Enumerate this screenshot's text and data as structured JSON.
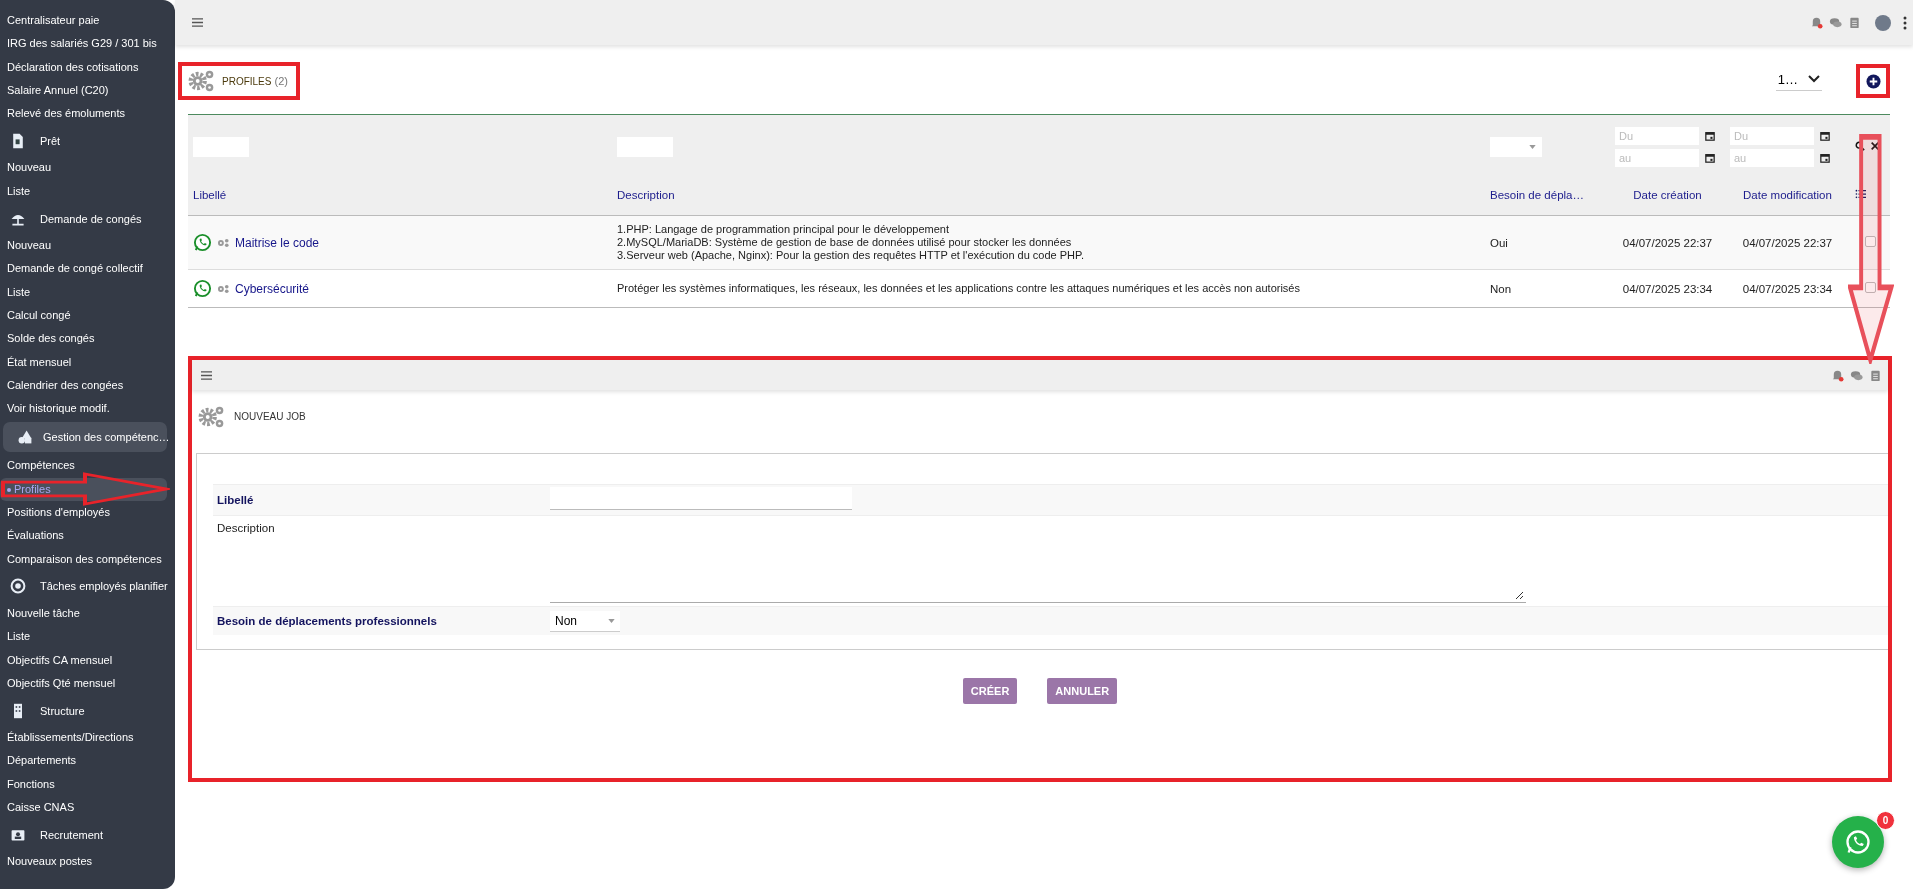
{
  "sidebar": {
    "items": [
      {
        "label": "Centralisateur paie",
        "kind": "link",
        "selected": false
      },
      {
        "label": "IRG des salariés G29 / 301 bis",
        "kind": "link",
        "selected": false
      },
      {
        "label": "Déclaration des cotisations",
        "kind": "link",
        "selected": false
      },
      {
        "label": "Salaire Annuel (C20)",
        "kind": "link",
        "selected": false
      },
      {
        "label": "Relevé des émoluments",
        "kind": "link",
        "selected": false
      },
      {
        "label": "Prêt",
        "kind": "section",
        "selected": false
      },
      {
        "label": "Nouveau",
        "kind": "link",
        "selected": false
      },
      {
        "label": "Liste",
        "kind": "link",
        "selected": false
      },
      {
        "label": "Demande de congés",
        "kind": "section",
        "selected": false
      },
      {
        "label": "Nouveau",
        "kind": "link",
        "selected": false
      },
      {
        "label": "Demande de congé collectif",
        "kind": "link",
        "selected": false
      },
      {
        "label": "Liste",
        "kind": "link",
        "selected": false
      },
      {
        "label": "Calcul congé",
        "kind": "link",
        "selected": false
      },
      {
        "label": "Solde des congés",
        "kind": "link",
        "selected": false
      },
      {
        "label": "État mensuel",
        "kind": "link",
        "selected": false
      },
      {
        "label": "Calendrier des congées",
        "kind": "link",
        "selected": false
      },
      {
        "label": "Voir historique modif.",
        "kind": "link",
        "selected": false
      },
      {
        "label": "Gestion des compétenc…",
        "kind": "group",
        "selected": false
      },
      {
        "label": "Compétences",
        "kind": "link",
        "selected": false
      },
      {
        "label": "Profiles",
        "kind": "link",
        "selected": true
      },
      {
        "label": "Positions d'employés",
        "kind": "link",
        "selected": false
      },
      {
        "label": "Évaluations",
        "kind": "link",
        "selected": false
      },
      {
        "label": "Comparaison des compétences",
        "kind": "link",
        "selected": false
      },
      {
        "label": "Tâches employés planifier",
        "kind": "section",
        "selected": false
      },
      {
        "label": "Nouvelle tâche",
        "kind": "link",
        "selected": false
      },
      {
        "label": "Liste",
        "kind": "link",
        "selected": false
      },
      {
        "label": "Objectifs CA mensuel",
        "kind": "link",
        "selected": false
      },
      {
        "label": "Objectifs Qté mensuel",
        "kind": "link",
        "selected": false
      },
      {
        "label": "Structure",
        "kind": "section",
        "selected": false
      },
      {
        "label": "Établissements/Directions",
        "kind": "link",
        "selected": false
      },
      {
        "label": "Départements",
        "kind": "link",
        "selected": false
      },
      {
        "label": "Fonctions",
        "kind": "link",
        "selected": false
      },
      {
        "label": "Caisse CNAS",
        "kind": "link",
        "selected": false
      },
      {
        "label": "Recrutement",
        "kind": "section",
        "selected": false
      },
      {
        "label": "Nouveaux postes",
        "kind": "link",
        "selected": false
      }
    ]
  },
  "page": {
    "title": "PROFILES",
    "count": "(2)",
    "page_size": "1…",
    "columns": [
      {
        "label": "Libellé",
        "kind": "text"
      },
      {
        "label": "Description",
        "kind": "text"
      },
      {
        "label": "Besoin de dépla…",
        "kind": "select"
      },
      {
        "label": "Date création",
        "kind": "date",
        "from": "Du",
        "to": "au"
      },
      {
        "label": "Date modification",
        "kind": "date",
        "from": "Du",
        "to": "au"
      }
    ],
    "rows": [
      {
        "label": "Maitrise le code",
        "description": "1.PHP: Langage de programmation principal pour le développement\n2.MySQL/MariaDB: Système de gestion de base de données utilisé pour stocker les données\n3.Serveur web (Apache, Nginx): Pour la gestion des requêtes HTTP et l'exécution du code PHP.",
        "travel": "Oui",
        "created": "04/07/2025 22:37",
        "modified": "04/07/2025 22:37",
        "checked": false
      },
      {
        "label": "Cybersécurité",
        "description": "Protéger les systèmes informatiques, les réseaux, les données et les applications contre les attaques numériques et les accès non autorisés",
        "travel": "Non",
        "created": "04/07/2025 23:34",
        "modified": "04/07/2025 23:34",
        "checked": false
      }
    ]
  },
  "form": {
    "title": "NOUVEAU JOB",
    "fields": [
      {
        "label": "Libellé",
        "kind": "text",
        "bold": true
      },
      {
        "label": "Description",
        "kind": "textarea",
        "bold": false
      },
      {
        "label": "Besoin de déplacements professionnels",
        "kind": "select",
        "bold": true,
        "value": "Non"
      }
    ],
    "buttons": [
      "CRÉER",
      "ANNULER"
    ]
  },
  "chat": {
    "badge": "0"
  }
}
